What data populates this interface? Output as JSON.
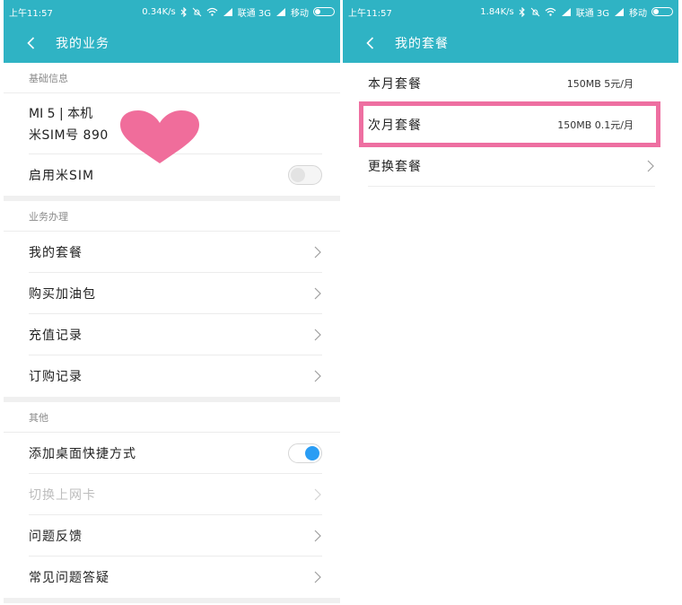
{
  "left": {
    "status": {
      "time": "上午11:57",
      "speed": "0.34K/s",
      "carrier1": "联通 3G",
      "carrier2": "移动"
    },
    "title": "我的业务",
    "section_basic": "基础信息",
    "sim": {
      "line1": "MI 5 | 本机",
      "line2": "米SIM号  890"
    },
    "enable_sim_label": "启用米SIM",
    "section_business": "业务办理",
    "business_items": [
      {
        "label": "我的套餐"
      },
      {
        "label": "购买加油包"
      },
      {
        "label": "充值记录"
      },
      {
        "label": "订购记录"
      }
    ],
    "section_other": "其他",
    "shortcut_label": "添加桌面快捷方式",
    "other_items": [
      {
        "label": "切换上网卡"
      },
      {
        "label": "问题反馈"
      },
      {
        "label": "常见问题答疑"
      }
    ]
  },
  "right": {
    "status": {
      "time": "上午11:57",
      "speed": "1.84K/s",
      "carrier1": "联通 3G",
      "carrier2": "移动"
    },
    "title": "我的套餐",
    "plans": [
      {
        "label": "本月套餐",
        "value": "150MB 5元/月"
      },
      {
        "label": "次月套餐",
        "value": "150MB 0.1元/月"
      },
      {
        "label": "更换套餐"
      }
    ]
  },
  "colors": {
    "accent": "#2fb3c4",
    "highlight": "#ee6fa1",
    "toggle_on": "#2a9df4",
    "heart": "#f06d9b"
  },
  "toggles": {
    "enable_sim": false,
    "desktop_shortcut": true
  }
}
